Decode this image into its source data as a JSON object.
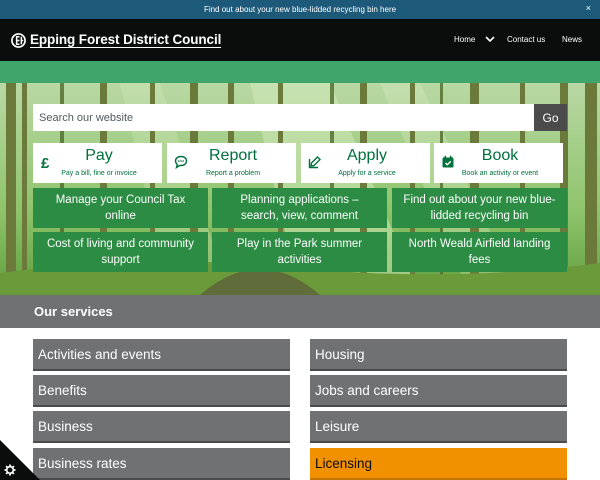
{
  "banner": {
    "text": "Find out about your new blue-lidded recycling bin here",
    "close": "×"
  },
  "header": {
    "council_name": "Epping Forest District Council",
    "nav": {
      "home": "Home",
      "contact": "Contact us",
      "news": "News"
    }
  },
  "search": {
    "placeholder": "Search our website",
    "button": "Go"
  },
  "quick_actions": [
    {
      "title": "Pay",
      "subtitle": "Pay a bill, fine or invoice",
      "icon": "pound-icon"
    },
    {
      "title": "Report",
      "subtitle": "Report a problem",
      "icon": "speech-bubble-icon"
    },
    {
      "title": "Apply",
      "subtitle": "Apply for a service",
      "icon": "pencil-icon"
    },
    {
      "title": "Book",
      "subtitle": "Book an activity or event",
      "icon": "calendar-icon"
    }
  ],
  "featured": [
    "Manage your Council Tax online",
    "Planning applications – search, view, comment",
    "Find out about your new blue-lidded recycling bin",
    "Cost of living and community support",
    "Play in the Park summer activities",
    "North Weald Airfield landing fees"
  ],
  "services": {
    "heading": "Our services",
    "left": [
      "Activities and events",
      "Benefits",
      "Business",
      "Business rates"
    ],
    "right": [
      "Housing",
      "Jobs and careers",
      "Leisure",
      "Licensing"
    ],
    "highlight_color": "#f29100"
  },
  "colors": {
    "brand_green": "#00703c",
    "banner_blue": "#1d5a7a"
  }
}
